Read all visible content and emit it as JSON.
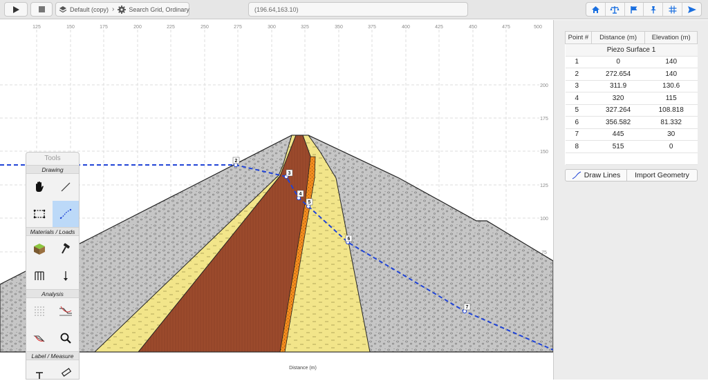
{
  "toolbar": {
    "play_icon": "play-icon",
    "stop_icon": "stop-icon",
    "breadcrumb": {
      "model": "Default (copy)",
      "analysis": "Search Grid, Ordinary"
    },
    "coordinates": "(196.64,163.10)",
    "right_icons": [
      "home-icon",
      "balance-icon",
      "flag-icon",
      "pin-icon",
      "grid-icon",
      "send-icon"
    ],
    "accent": "#1a6fe0"
  },
  "canvas": {
    "x_ticks": [
      "125",
      "150",
      "175",
      "200",
      "225",
      "250",
      "275",
      "300",
      "325",
      "350",
      "375",
      "400",
      "425",
      "450",
      "475",
      "500"
    ],
    "y_ticks": [
      "200",
      "175",
      "150",
      "125",
      "100",
      "75"
    ],
    "x_axis_label": "Distance (m)",
    "piezo_line_color": "#1f43d6",
    "point_labels": [
      "2",
      "3",
      "4",
      "5",
      "6",
      "7"
    ]
  },
  "tools_panel": {
    "title": "Tools",
    "sections": {
      "drawing": "Drawing",
      "materials": "Materials / Loads",
      "analysis": "Analysis",
      "label": "Label / Measure"
    }
  },
  "points_table": {
    "headers": [
      "Point #",
      "Distance (m)",
      "Elevation (m)"
    ],
    "surface_name": "Piezo Surface 1",
    "rows": [
      [
        "1",
        "0",
        "140"
      ],
      [
        "2",
        "272.654",
        "140"
      ],
      [
        "3",
        "311.9",
        "130.6"
      ],
      [
        "4",
        "320",
        "115"
      ],
      [
        "5",
        "327.264",
        "108.818"
      ],
      [
        "6",
        "356.582",
        "81.332"
      ],
      [
        "7",
        "445",
        "30"
      ],
      [
        "8",
        "515",
        "0"
      ]
    ]
  },
  "segment": {
    "draw_lines": "Draw Lines",
    "import_geometry": "Import Geometry"
  }
}
